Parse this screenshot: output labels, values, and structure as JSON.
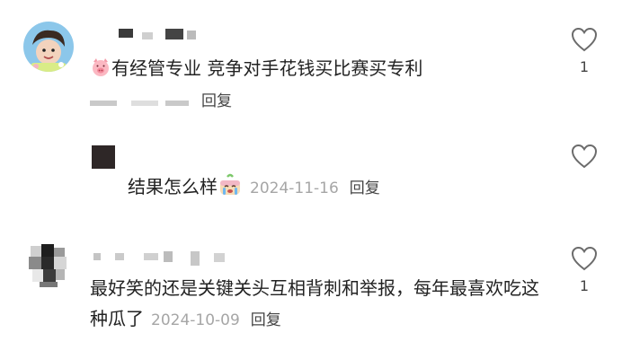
{
  "comments": [
    {
      "text_visible": "经管专业 竞争对手花钱买比赛买专利",
      "text_partial_char": "有",
      "meta_reply": "回复",
      "like_count": "1"
    },
    {
      "text": "结果怎么样",
      "date": "2024-11-16",
      "meta_reply": "回复"
    },
    {
      "text": "最好笑的还是关键关头互相背刺和举报，每年最喜欢吃这种瓜了",
      "date": "2024-10-09",
      "meta_reply": "回复",
      "like_count": "1"
    }
  ],
  "icons": {
    "heart": "heart-outline-icon",
    "emoji_pig": "pig-face-emoji",
    "emoji_crying": "crying-cake-emoji"
  },
  "colors": {
    "text": "#222222",
    "meta": "#a6a6a6",
    "reply": "#444444"
  }
}
